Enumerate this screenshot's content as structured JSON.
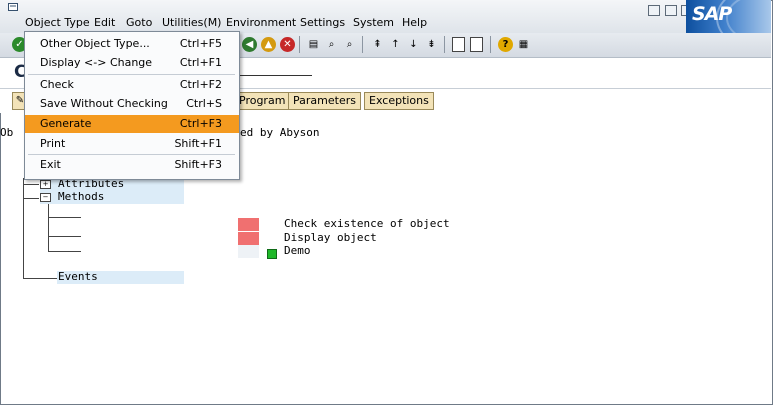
{
  "menubar": {
    "items": [
      "Object Type",
      "Edit",
      "Goto",
      "Utilities(M)",
      "Environment",
      "Settings",
      "System",
      "Help"
    ],
    "logo_text": "SAP"
  },
  "title": {
    "text": "C"
  },
  "tabs": {
    "buttons": [
      "Program",
      "Parameters",
      "Exceptions"
    ]
  },
  "object_info": {
    "text": "Ob",
    "text_right": "ed by Abyson"
  },
  "tree": {
    "nodes": [
      "Attributes",
      "Methods",
      "Events"
    ],
    "methods": [
      "Check existence of object",
      "Display object",
      "Demo"
    ]
  },
  "dropdown": {
    "items": [
      {
        "label": "Other Object Type...",
        "shortcut": "Ctrl+F5"
      },
      {
        "label": "Display <-> Change",
        "shortcut": "Ctrl+F1"
      },
      {
        "label": "Check",
        "shortcut": "Ctrl+F2"
      },
      {
        "label": "Save Without Checking",
        "shortcut": "Ctrl+S"
      },
      {
        "label": "Generate",
        "shortcut": "Ctrl+F3",
        "highlighted": true
      },
      {
        "label": "Print",
        "shortcut": "Shift+F1"
      },
      {
        "label": "Exit",
        "shortcut": "Shift+F3"
      }
    ]
  },
  "colors": {
    "highlight": "#f49a1f",
    "method_swatch": "#f07070",
    "node_bg": "#dcecf8",
    "button_bg": "#f3e3b8"
  }
}
